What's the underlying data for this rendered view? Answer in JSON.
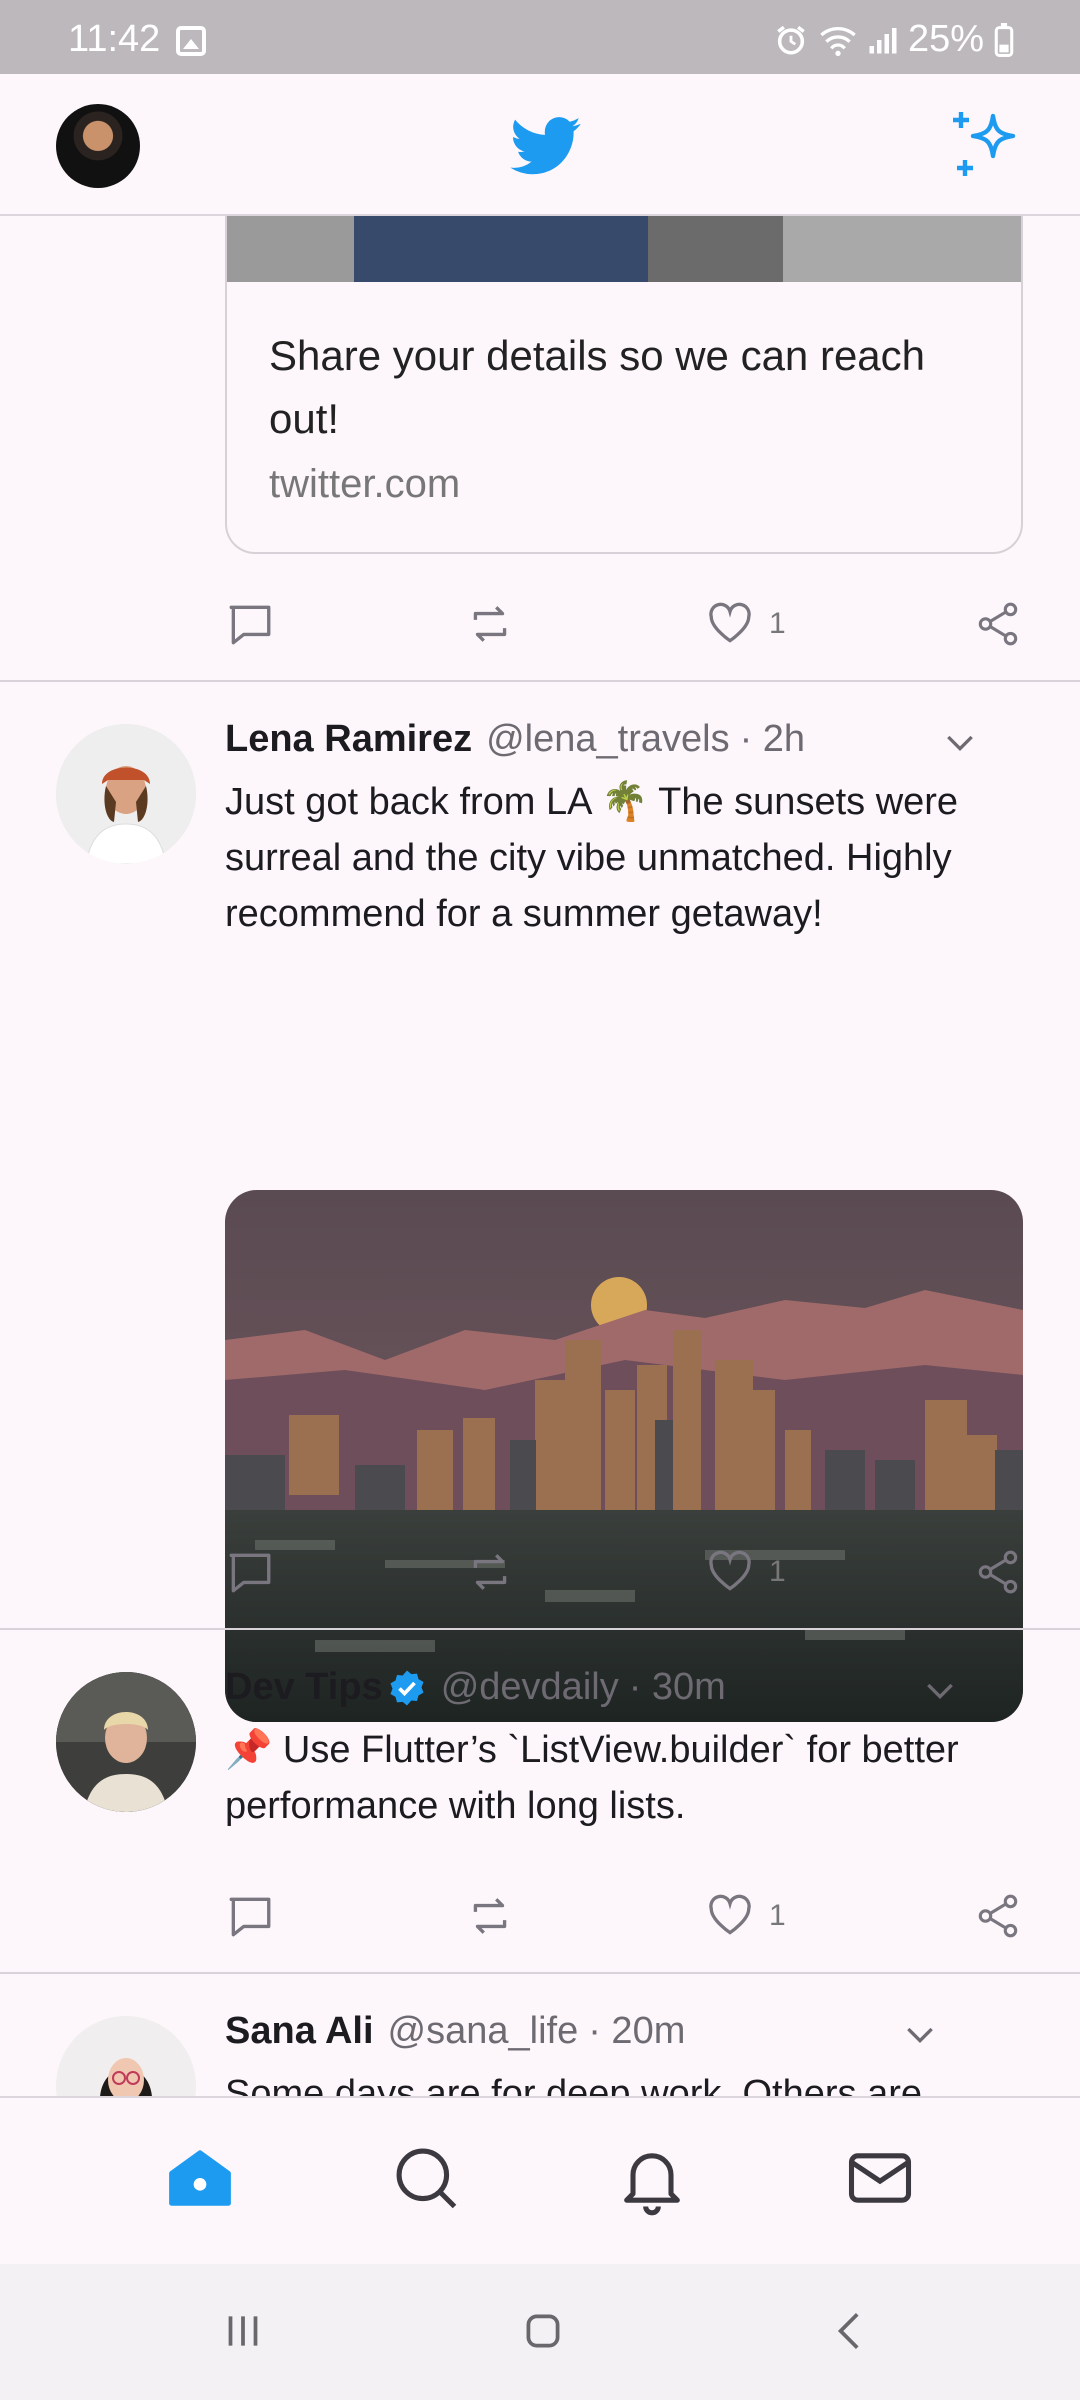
{
  "status_bar": {
    "time": "11:42",
    "battery": "25%"
  },
  "top_bar": {
    "profile_avatar": "avatar-me",
    "logo": "twitter-bird-icon",
    "action": "sparkle-icon"
  },
  "link_card": {
    "title": "Share your details so we can reach out!",
    "domain": "twitter.com",
    "like_count": "1"
  },
  "tweets": [
    {
      "name": "Lena Ramirez",
      "handle": "@lena_travels",
      "time": "· 2h",
      "verified": false,
      "text": "Just got back from LA 🌴 The sunsets were surreal and the city vibe unmatched. Highly recommend for a summer getaway!",
      "like_count": "1"
    },
    {
      "name": "Dev Tips",
      "handle": "@devdaily",
      "time": "· 30m",
      "verified": true,
      "text": "📌 Use Flutter’s `ListView.builder` for better performance with long lists.",
      "like_count": "1"
    },
    {
      "name": "Sana Ali",
      "handle": "@sana_life",
      "time": "· 20m",
      "verified": false,
      "text": "Some days are for deep work. Others are"
    }
  ],
  "bottom_nav": [
    "home-icon",
    "search-icon",
    "bell-icon",
    "mail-icon"
  ],
  "colors": {
    "accent": "#1d9bf0",
    "background": "#fdf7fc",
    "icon_gray": "#7a7680"
  }
}
